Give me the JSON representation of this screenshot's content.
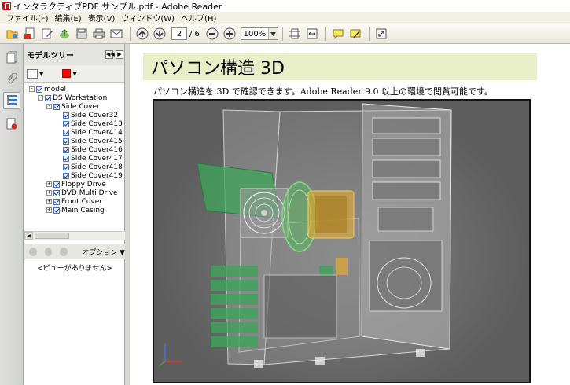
{
  "window": {
    "title": "インタラクティブPDF サンプル.pdf - Adobe Reader"
  },
  "menu": [
    "ファイル(F)",
    "編集(E)",
    "表示(V)",
    "ウィンドウ(W)",
    "ヘルプ(H)"
  ],
  "toolbar": {
    "page_current": "2",
    "page_total": "/ 6",
    "zoom": "100%"
  },
  "panel": {
    "title": "モデルツリー",
    "tree": [
      {
        "label": "model",
        "depth": 0,
        "toggle": "-"
      },
      {
        "label": "DS Workstation",
        "depth": 1,
        "toggle": "-"
      },
      {
        "label": "Side Cover",
        "depth": 2,
        "toggle": "-"
      },
      {
        "label": "Side Cover32",
        "depth": 3,
        "toggle": ""
      },
      {
        "label": "Side Cover413",
        "depth": 3,
        "toggle": ""
      },
      {
        "label": "Side Cover414",
        "depth": 3,
        "toggle": ""
      },
      {
        "label": "Side Cover415",
        "depth": 3,
        "toggle": ""
      },
      {
        "label": "Side Cover416",
        "depth": 3,
        "toggle": ""
      },
      {
        "label": "Side Cover417",
        "depth": 3,
        "toggle": ""
      },
      {
        "label": "Side Cover418",
        "depth": 3,
        "toggle": ""
      },
      {
        "label": "Side Cover419",
        "depth": 3,
        "toggle": ""
      },
      {
        "label": "Floppy Drive",
        "depth": 2,
        "toggle": "+"
      },
      {
        "label": "DVD Multi Drive",
        "depth": 2,
        "toggle": "+"
      },
      {
        "label": "Front Cover",
        "depth": 2,
        "toggle": "+"
      },
      {
        "label": "Main Casing",
        "depth": 2,
        "toggle": "+"
      }
    ],
    "options_label": "オプション",
    "no_views": "<ビューがありません>"
  },
  "document": {
    "heading": "パソコン構造 3D",
    "intro": "パソコン構造を 3D で確認できます。Adobe Reader 9.0 以上の環境で閲覧可能です。"
  },
  "colors": {
    "heading_bg": "#e8efc8",
    "color_swatch": "#ff0000",
    "viewer_bg": "#6e6e6e"
  }
}
